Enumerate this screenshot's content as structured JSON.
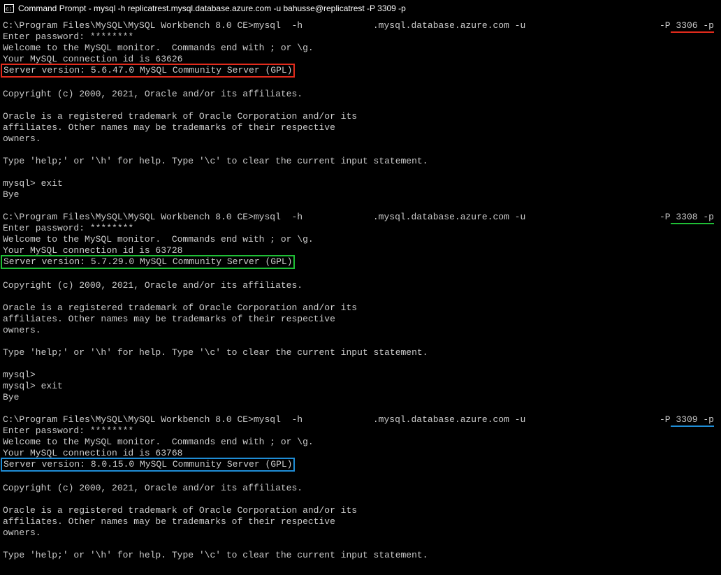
{
  "title": "Command Prompt - mysql   -h replicatrest.mysql.database.azure.com -u bahusse@replicatrest -P 3309 -p",
  "common": {
    "prompt_path": "C:\\Program Files\\MySQL\\MySQL Workbench 8.0 CE>",
    "cmd_prefix": "mysql  -h ",
    "host_suffix": ".mysql.database.azure.com -u ",
    "password_line": "Enter password: ********",
    "welcome": "Welcome to the MySQL monitor.  Commands end with ; or \\g.",
    "copyright": "Copyright (c) 2000, 2021, Oracle and/or its affiliates.",
    "trademark1": "Oracle is a registered trademark of Oracle Corporation and/or its",
    "trademark2": "affiliates. Other names may be trademarks of their respective",
    "trademark3": "owners.",
    "help": "Type 'help;' or '\\h' for help. Type '\\c' to clear the current input statement.",
    "mysql_prompt": "mysql>",
    "exit": "mysql> exit",
    "bye": "Bye"
  },
  "sessions": [
    {
      "port_label": "-P 3306 -p",
      "conn_id": "Your MySQL connection id is 63626",
      "version": "Server version: 5.6.47.0 MySQL Community Server (GPL)",
      "color": "red",
      "post": [
        "mysql> exit",
        "Bye"
      ]
    },
    {
      "port_label": "-P 3308 -p",
      "conn_id": "Your MySQL connection id is 63728",
      "version": "Server version: 5.7.29.0 MySQL Community Server (GPL)",
      "color": "green",
      "post": [
        "mysql>",
        "mysql> exit",
        "Bye"
      ]
    },
    {
      "port_label": "-P 3309 -p",
      "conn_id": "Your MySQL connection id is 63768",
      "version": "Server version: 8.0.15.0 MySQL Community Server (GPL)",
      "color": "blue",
      "post": []
    }
  ]
}
